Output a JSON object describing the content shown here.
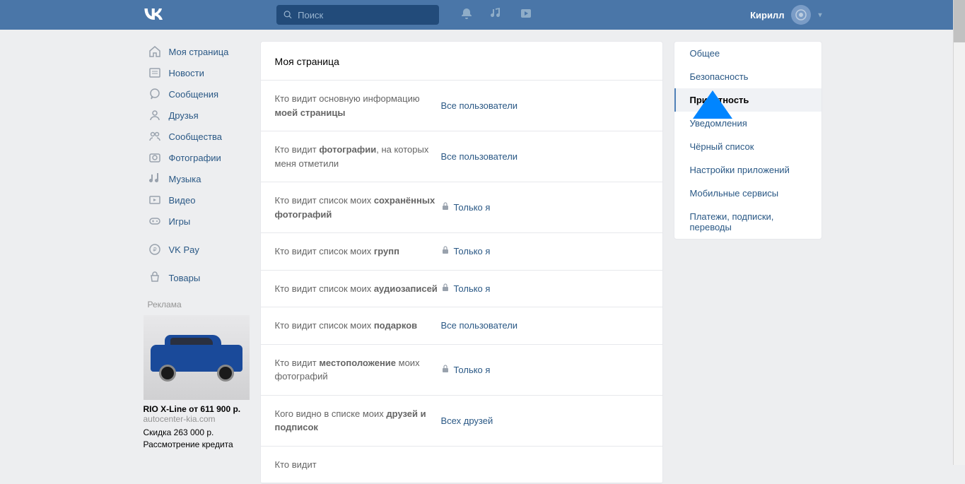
{
  "header": {
    "logo": "VK",
    "search_placeholder": "Поиск",
    "user_name": "Кирилл"
  },
  "sidebar": {
    "items": [
      {
        "label": "Моя страница",
        "icon": "home"
      },
      {
        "label": "Новости",
        "icon": "news"
      },
      {
        "label": "Сообщения",
        "icon": "messages"
      },
      {
        "label": "Друзья",
        "icon": "friends"
      },
      {
        "label": "Сообщества",
        "icon": "communities"
      },
      {
        "label": "Фотографии",
        "icon": "photos"
      },
      {
        "label": "Музыка",
        "icon": "music"
      },
      {
        "label": "Видео",
        "icon": "video"
      },
      {
        "label": "Игры",
        "icon": "games"
      }
    ],
    "extra1": {
      "label": "VK Pay",
      "icon": "pay"
    },
    "extra2": {
      "label": "Товары",
      "icon": "market"
    },
    "ad_label": "Реклама",
    "ad": {
      "title": "RIO X-Line от 611 900 р.",
      "domain": "autocenter-kia.com",
      "line1": "Скидка 263 000 р.",
      "line2": "Рассмотрение кредита"
    }
  },
  "main": {
    "title": "Моя страница",
    "settings": [
      {
        "label_pre": "Кто видит основную информацию ",
        "label_bold": "моей страницы",
        "value": "Все пользователи",
        "locked": false
      },
      {
        "label_pre": "Кто видит ",
        "label_bold": "фотографии",
        "label_post": ", на которых меня отметили",
        "value": "Все пользователи",
        "locked": false
      },
      {
        "label_pre": "Кто видит список моих ",
        "label_bold": "сохранённых фотографий",
        "value": "Только я",
        "locked": true
      },
      {
        "label_pre": "Кто видит список моих ",
        "label_bold": "групп",
        "value": "Только я",
        "locked": true
      },
      {
        "label_pre": "Кто видит список моих ",
        "label_bold": "аудиозаписей",
        "value": "Только я",
        "locked": true
      },
      {
        "label_pre": "Кто видит список моих ",
        "label_bold": "подарков",
        "value": "Все пользователи",
        "locked": false
      },
      {
        "label_pre": "Кто видит ",
        "label_bold": "местоположение",
        "label_post": " моих фотографий",
        "value": "Только я",
        "locked": true
      },
      {
        "label_pre": "Кого видно в списке моих ",
        "label_bold": "друзей и подписок",
        "value": "Всех друзей",
        "locked": false
      },
      {
        "label_pre": "Кто видит",
        "label_bold": "",
        "value": "",
        "locked": false
      }
    ]
  },
  "right": {
    "items": [
      {
        "label": "Общее",
        "active": false
      },
      {
        "label": "Безопасность",
        "active": false
      },
      {
        "label": "Приватность",
        "active": true
      },
      {
        "label": "Уведомления",
        "active": false
      },
      {
        "label": "Чёрный список",
        "active": false
      },
      {
        "label": "Настройки приложений",
        "active": false
      },
      {
        "label": "Мобильные сервисы",
        "active": false
      },
      {
        "label": "Платежи, подписки, переводы",
        "active": false
      }
    ]
  }
}
